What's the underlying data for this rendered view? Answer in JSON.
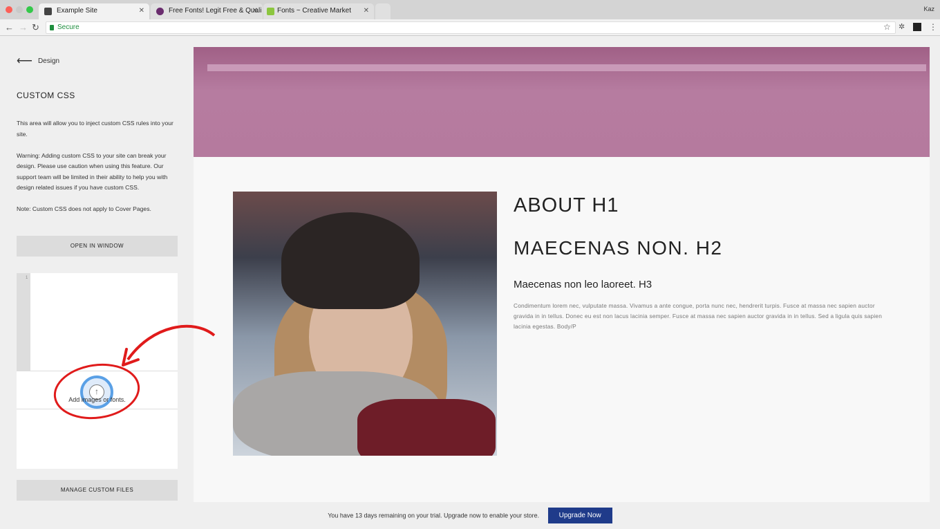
{
  "browser": {
    "tabs": [
      {
        "label": "Example Site",
        "active": true
      },
      {
        "label": "Free Fonts! Legit Free & Quali",
        "active": false
      },
      {
        "label": "Fonts ~ Creative Market",
        "active": false
      }
    ],
    "user": "Kaz",
    "security_label": "Secure"
  },
  "sidebar": {
    "back_label": "Design",
    "title": "CUSTOM CSS",
    "desc1": "This area will allow you to inject custom CSS rules into your site.",
    "desc2": "Warning: Adding custom CSS to your site can break your design. Please use caution when using this feature. Our support team will be limited in their ability to help you with design related issues if you have custom CSS.",
    "desc3": "Note: Custom CSS does not apply to Cover Pages.",
    "open_window_label": "OPEN IN WINDOW",
    "line_number": "1",
    "add_files_label": "Add images or fonts.",
    "manage_label": "MANAGE CUSTOM FILES"
  },
  "preview": {
    "h1": "ABOUT H1",
    "h2": "MAECENAS NON. H2",
    "h3": "Maecenas non leo laoreet. H3",
    "body": "Condimentum lorem nec, vulputate massa. Vivamus a ante congue, porta nunc nec, hendrerit turpis. Fusce at massa nec sapien auctor gravida in in tellus. Donec eu est non lacus lacinia semper. Fusce at massa nec sapien auctor gravida in in tellus. Sed a ligula quis sapien lacinia egestas. Body/P"
  },
  "trial": {
    "message": "You have 13 days remaining on your trial. Upgrade now to enable your store.",
    "button": "Upgrade Now"
  },
  "colors": {
    "accent": "#1f3b8a",
    "annotation": "#e01b1b",
    "hero_overlay": "#b07698"
  }
}
